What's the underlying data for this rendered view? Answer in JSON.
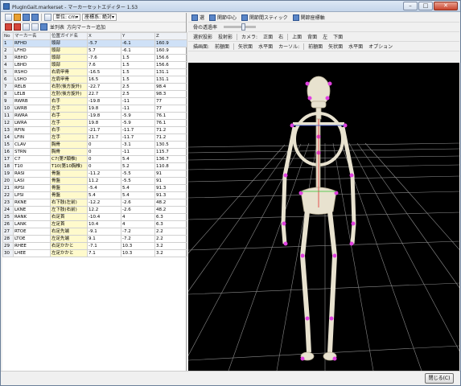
{
  "window": {
    "title": "PlugInGait.markerset - マーカーセットエディター 1.53",
    "minimize": "–",
    "maximize": "□",
    "close": "✕"
  },
  "left_toolbar": {
    "unit_label": "単位: cm▾",
    "coord_label": "座標系: 絶対▾",
    "list_label": "並列表",
    "rename_label": "方向マーカー追加"
  },
  "table": {
    "headers": [
      "No",
      "マーカー名",
      "位置ガイド名",
      "X",
      "Y",
      "Z"
    ],
    "rows": [
      [
        "1",
        "RFHD",
        "頭部",
        "-5.7",
        "-6.1",
        "160.9"
      ],
      [
        "2",
        "LFHD",
        "頭部",
        "5.7",
        "-6.1",
        "160.9"
      ],
      [
        "3",
        "RBHD",
        "頭部",
        "-7.6",
        "1.5",
        "156.6"
      ],
      [
        "4",
        "LBHD",
        "頭部",
        "7.6",
        "1.5",
        "156.6"
      ],
      [
        "5",
        "RSHO",
        "右肩甲骨",
        "-16.5",
        "1.5",
        "131.1"
      ],
      [
        "6",
        "LSHO",
        "左肩甲骨",
        "16.5",
        "1.5",
        "131.1"
      ],
      [
        "7",
        "RELB",
        "右肘(後方旋外)",
        "-22.7",
        "2.5",
        "98.4"
      ],
      [
        "8",
        "LELB",
        "左肘(後方旋外)",
        "22.7",
        "2.5",
        "98.3"
      ],
      [
        "9",
        "RWRB",
        "右手",
        "-19.8",
        "-11",
        "77"
      ],
      [
        "10",
        "LWRB",
        "左手",
        "19.8",
        "-11",
        "77"
      ],
      [
        "11",
        "RWRA",
        "右手",
        "-19.8",
        "-5.9",
        "76.1"
      ],
      [
        "12",
        "LWRA",
        "左手",
        "19.8",
        "-5.9",
        "76.1"
      ],
      [
        "13",
        "RFIN",
        "右手",
        "-21.7",
        "-11.7",
        "71.2"
      ],
      [
        "14",
        "LFIN",
        "左手",
        "21.7",
        "-11.7",
        "71.2"
      ],
      [
        "15",
        "CLAV",
        "胸骨",
        "0",
        "-3.1",
        "130.5"
      ],
      [
        "16",
        "STRN",
        "胸骨",
        "0",
        "-11",
        "115.7"
      ],
      [
        "17",
        "C7",
        "C7(第7頸椎)",
        "0",
        "5.4",
        "136.7"
      ],
      [
        "18",
        "T10",
        "T10(第10胸椎)",
        "0",
        "5.2",
        "110.8"
      ],
      [
        "19",
        "RASI",
        "骨盤",
        "-11.2",
        "-5.5",
        "91"
      ],
      [
        "20",
        "LASI",
        "骨盤",
        "11.2",
        "-5.5",
        "91"
      ],
      [
        "21",
        "RPSI",
        "骨盤",
        "-5.4",
        "5.4",
        "91.3"
      ],
      [
        "22",
        "LPSI",
        "骨盤",
        "5.4",
        "5.4",
        "91.3"
      ],
      [
        "23",
        "RKNE",
        "右下肢(左前)",
        "-12.2",
        "-2.6",
        "48.2"
      ],
      [
        "24",
        "LKNE",
        "左下肢(右前)",
        "12.2",
        "-2.6",
        "48.2"
      ],
      [
        "25",
        "RANK",
        "右足首",
        "-10.4",
        "4",
        "6.3"
      ],
      [
        "26",
        "LANK",
        "左足首",
        "10.4",
        "4",
        "6.3"
      ],
      [
        "27",
        "RTOE",
        "右足先端",
        "-9.1",
        "-7.2",
        "2.2"
      ],
      [
        "28",
        "LTOE",
        "左足先端",
        "9.1",
        "-7.2",
        "2.2"
      ],
      [
        "29",
        "RHEE",
        "右足かかと",
        "-7.1",
        "10.3",
        "3.2"
      ],
      [
        "30",
        "LHEE",
        "左足かかと",
        "7.1",
        "10.3",
        "3.2"
      ]
    ]
  },
  "right_toolbar1": {
    "b1": "選",
    "b2": "関節中心",
    "b3": "関節間スティック",
    "b4": "関節座標軸"
  },
  "right_toolbar2": {
    "bone_label": "骨の透過率"
  },
  "right_toolbar3": {
    "items": [
      "選択投影",
      "投射影",
      "カメラ:",
      "正面",
      "右",
      "上面",
      "背面",
      "左",
      "下面"
    ]
  },
  "right_toolbar4": {
    "items": [
      "描画面:",
      "前額面",
      "矢状面",
      "水平面",
      "カーソル:",
      "前額面",
      "矢状面",
      "水平面",
      "オプション"
    ]
  },
  "footer": {
    "ok_label": "閉じる(C)"
  }
}
